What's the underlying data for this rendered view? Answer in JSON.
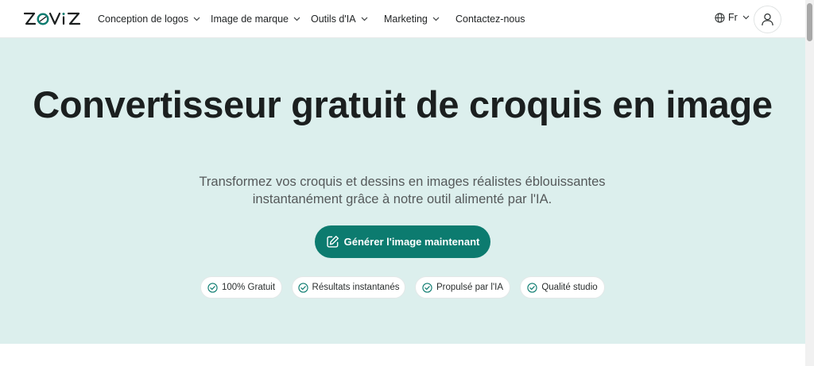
{
  "brand": {
    "logo_text": "ZOVIZ",
    "accent_color": "#0c7b6f",
    "hero_bg": "#dcefed"
  },
  "nav": {
    "items": [
      {
        "label": "Conception de logos",
        "has_dropdown": true
      },
      {
        "label": "Image de marque",
        "has_dropdown": true
      },
      {
        "label": "Outils d'IA",
        "has_dropdown": true
      },
      {
        "label": "Marketing",
        "has_dropdown": true
      },
      {
        "label": "Contactez-nous",
        "has_dropdown": false
      }
    ],
    "language": "Fr",
    "icons": {
      "language": "globe-icon",
      "account": "user-icon",
      "dropdown": "chevron-down-icon"
    }
  },
  "hero": {
    "title": "Convertisseur gratuit de croquis en image",
    "subtitle": "Transformez vos croquis et dessins en images réalistes éblouissantes instantanément grâce à notre outil alimenté par l'IA.",
    "cta_label": "Générer l'image maintenant",
    "cta_icon": "edit-icon",
    "features": [
      {
        "label": "100% Gratuit",
        "icon": "check-circle-icon"
      },
      {
        "label": "Résultats instantanés",
        "icon": "check-circle-icon"
      },
      {
        "label": "Propulsé par l'IA",
        "icon": "check-circle-icon"
      },
      {
        "label": "Qualité studio",
        "icon": "check-circle-icon"
      }
    ]
  }
}
